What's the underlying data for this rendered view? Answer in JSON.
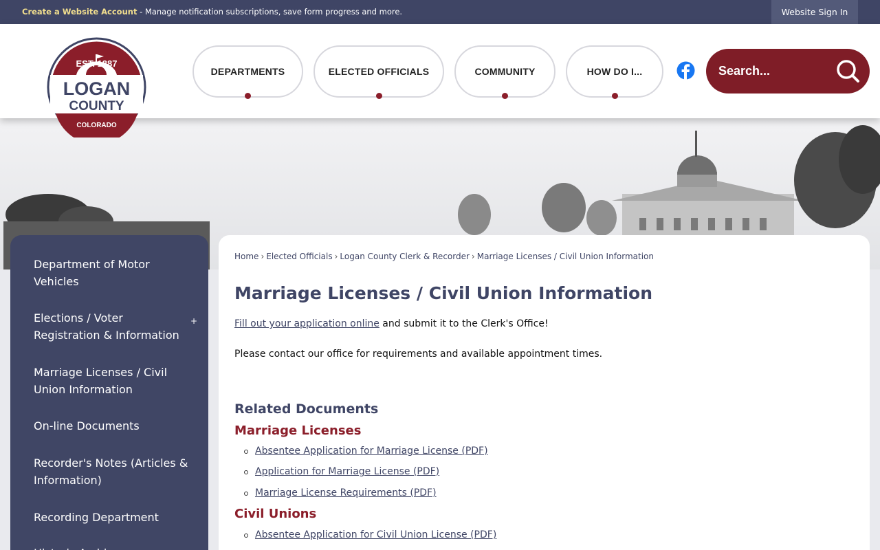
{
  "topbar": {
    "account_link": "Create a Website Account",
    "message": " - Manage notification subscriptions, save form progress and more.",
    "signin": "Website Sign In"
  },
  "logo": {
    "est": "EST. 1887",
    "line1": "LOGAN",
    "line2": "COUNTY",
    "state": "COLORADO"
  },
  "nav": [
    {
      "label": "DEPARTMENTS"
    },
    {
      "label": "ELECTED OFFICIALS"
    },
    {
      "label": "COMMUNITY"
    },
    {
      "label": "HOW DO I..."
    }
  ],
  "search": {
    "placeholder": "Search..."
  },
  "sidebar": {
    "items": [
      {
        "label": "Department of Motor Vehicles"
      },
      {
        "label": "Elections / Voter Registration & Information",
        "expand": "+"
      },
      {
        "label": "Marriage Licenses / Civil Union Information"
      },
      {
        "label": "On-line Documents"
      },
      {
        "label": "Recorder's Notes (Articles & Information)"
      },
      {
        "label": "Recording Department"
      },
      {
        "label": "Historic Archives"
      }
    ]
  },
  "breadcrumb": {
    "items": [
      "Home",
      "Elected Officials",
      "Logan County Clerk & Recorder",
      "Marriage Licenses / Civil Union Information"
    ],
    "separator": "›"
  },
  "page": {
    "title": "Marriage Licenses / Civil Union Information",
    "intro_link": "Fill out your application online",
    "intro_rest": " and submit it to the Clerk's Office!",
    "contact": "Please contact our office for requirements and available appointment times."
  },
  "related": {
    "heading": "Related Documents",
    "groups": [
      {
        "title": "Marriage Licenses",
        "docs": [
          "Absentee Application for Marriage License (PDF)",
          "Application for Marriage License (PDF)",
          "Marriage License Requirements (PDF)"
        ]
      },
      {
        "title": "Civil Unions",
        "docs": [
          "Absentee Application for Civil Union License (PDF)"
        ]
      }
    ]
  },
  "colors": {
    "navy": "#3f4565",
    "maroon": "#8b1e2a",
    "gold": "#f1de8e",
    "facebook": "#1877f2"
  }
}
